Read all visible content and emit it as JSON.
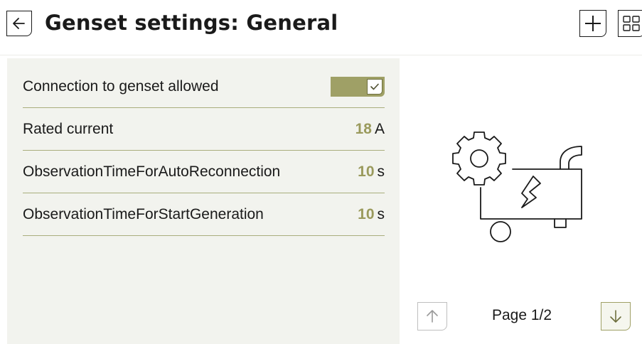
{
  "header": {
    "title": "Genset settings: General",
    "back_icon": "arrow-left-icon",
    "add_icon": "plus-icon",
    "grid_icon": "grid-icon"
  },
  "settings": {
    "rows": [
      {
        "label": "Connection to genset allowed",
        "type": "toggle",
        "checked": true
      },
      {
        "label": "Rated current",
        "value": "18",
        "unit": "A"
      },
      {
        "label": "ObservationTimeForAutoReconnection",
        "value": "10",
        "unit": "s"
      },
      {
        "label": "ObservationTimeForStartGeneration",
        "value": "10",
        "unit": "s"
      }
    ]
  },
  "illustration": {
    "icon": "genset-icon"
  },
  "pagination": {
    "label": "Page 1/2",
    "up_icon": "arrow-up-icon",
    "down_icon": "arrow-down-icon"
  },
  "colors": {
    "accent": "#9fa066",
    "value_text": "#9a9a5c",
    "panel_bg": "#f2f3ee",
    "divider": "#a9ae7d"
  }
}
